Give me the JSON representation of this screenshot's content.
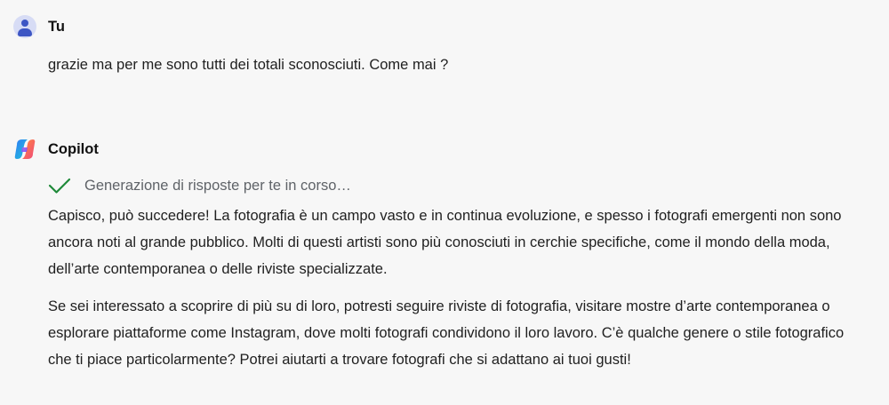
{
  "user_message": {
    "author": "Tu",
    "text": "grazie ma per me sono tutti dei totali sconosciuti. Come mai ?"
  },
  "assistant_message": {
    "author": "Copilot",
    "status": "Generazione di risposte per te in corso…",
    "paragraphs": [
      "Capisco, può succedere! La fotografia è un campo vasto e in continua evoluzione, e spesso i fotografi emergenti non sono ancora noti al grande pubblico. Molti di questi artisti sono più conosciuti in cerchie specifiche, come il mondo della moda, dell’arte contemporanea o delle riviste specializzate.",
      "Se sei interessato a scoprire di più su di loro, potresti seguire riviste di fotografia, visitare mostre d’arte contemporanea o esplorare piattaforme come Instagram, dove molti fotografi condividono il loro lavoro. C’è qualche genere o stile fotografico che ti piace particolarmente? Potrei aiutarti a trovare fotografi che si adattano ai tuoi gusti!"
    ]
  },
  "icons": {
    "user_avatar": "user-avatar-icon",
    "assistant_avatar": "copilot-logo-icon",
    "status": "check-icon"
  },
  "colors": {
    "background": "#f7f7f7",
    "text": "#1f1f1f",
    "status_text": "#5f6368",
    "check": "#1f8a3a",
    "user_avatar_bg": "#d7dcf5",
    "user_avatar_fg": "#3d56c4"
  }
}
